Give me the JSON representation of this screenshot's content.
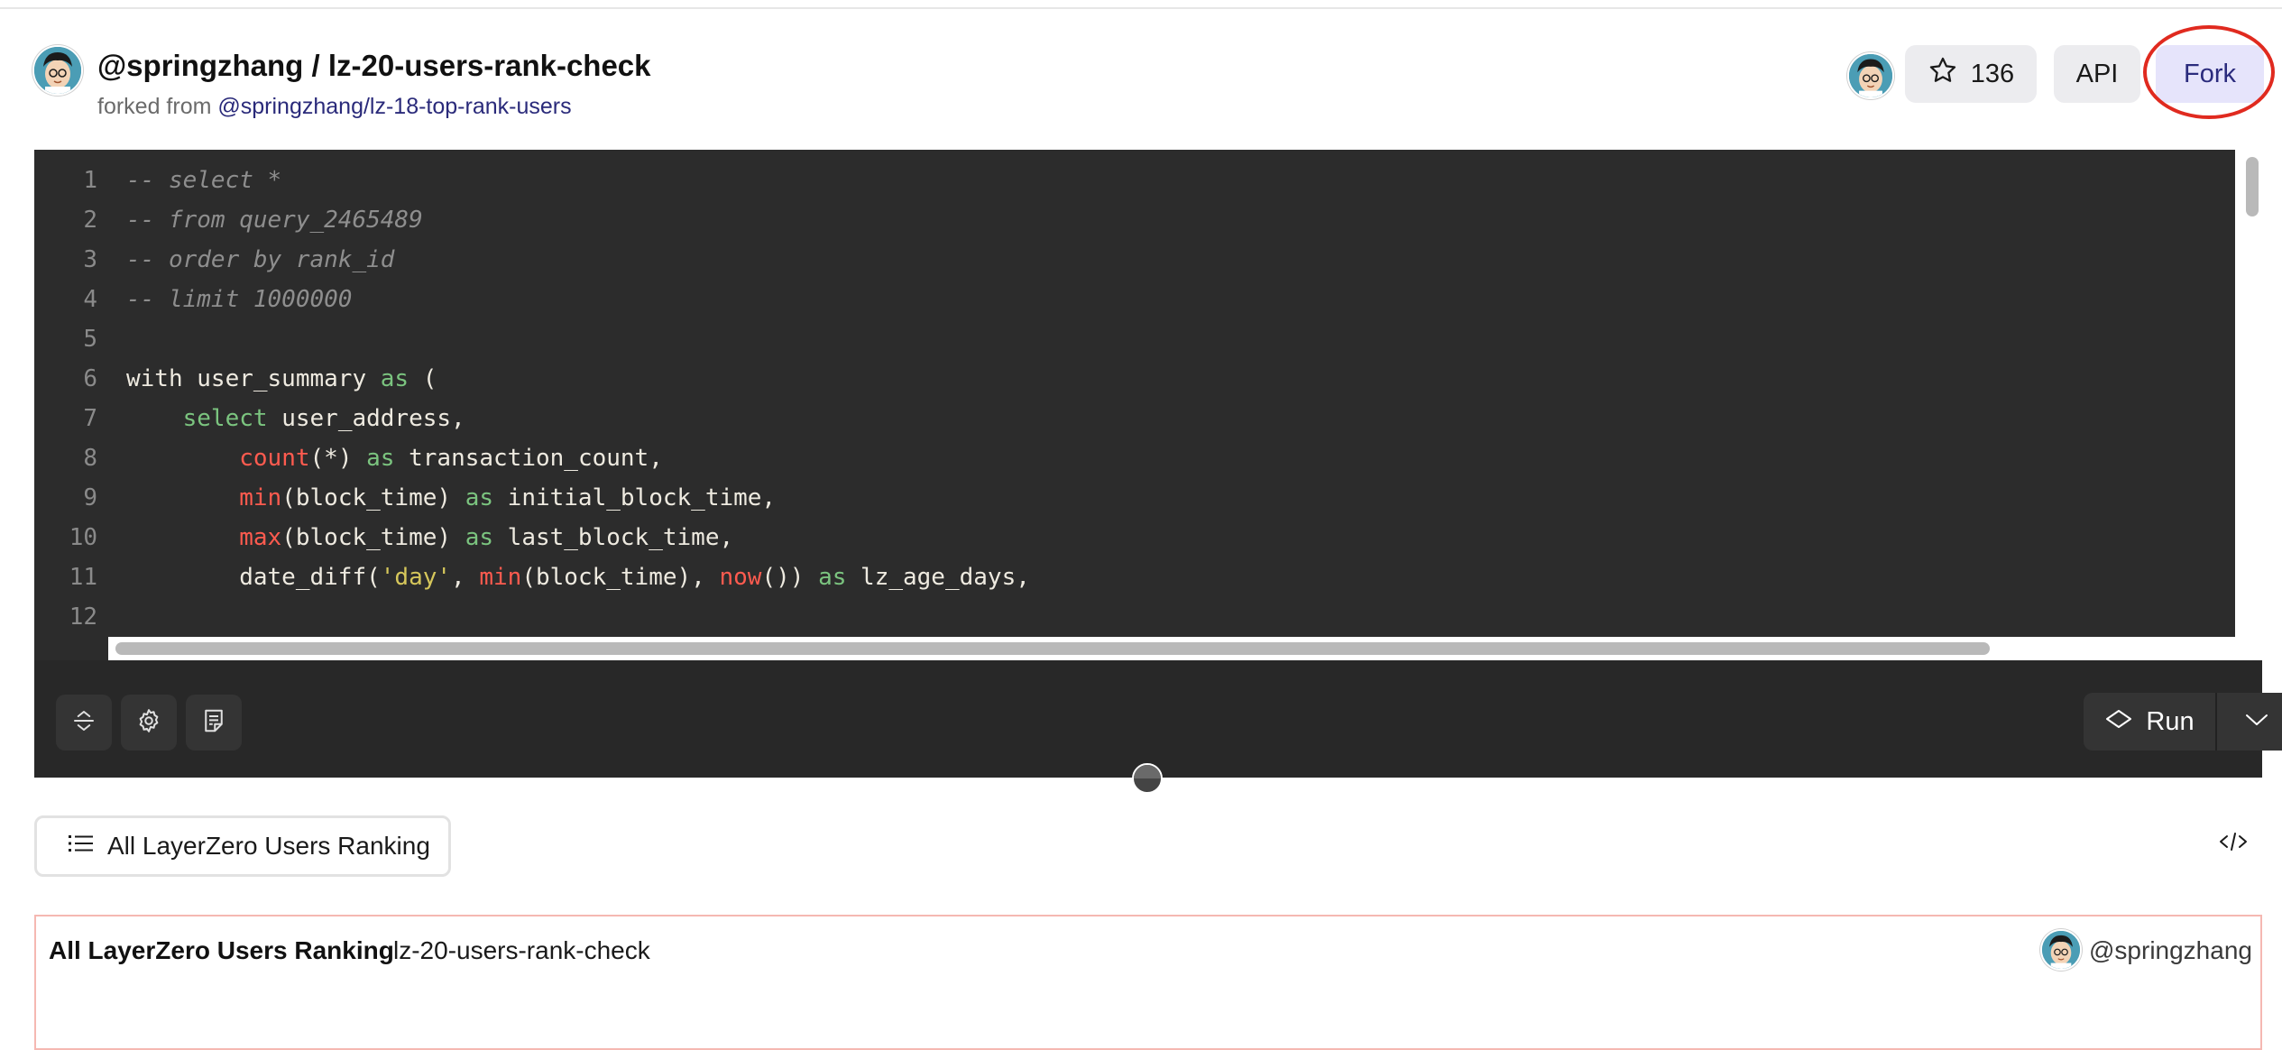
{
  "header": {
    "title": "@springzhang / lz-20-users-rank-check",
    "forked_prefix": "forked from",
    "forked_link": "@springzhang/lz-18-top-rank-users",
    "star_count": "136",
    "api_label": "API",
    "fork_label": "Fork"
  },
  "editor": {
    "lines": [
      {
        "n": "1",
        "segs": [
          {
            "t": "-- select *",
            "c": "com"
          }
        ]
      },
      {
        "n": "2",
        "segs": [
          {
            "t": "-- from query_2465489",
            "c": "com"
          }
        ]
      },
      {
        "n": "3",
        "segs": [
          {
            "t": "-- order by rank_id",
            "c": "com"
          }
        ]
      },
      {
        "n": "4",
        "segs": [
          {
            "t": "-- limit 1000000",
            "c": "com"
          }
        ]
      },
      {
        "n": "5",
        "segs": []
      },
      {
        "n": "6",
        "segs": [
          {
            "t": "with user_summary ",
            "c": ""
          },
          {
            "t": "as",
            "c": "kw"
          },
          {
            "t": " (",
            "c": ""
          }
        ]
      },
      {
        "n": "7",
        "segs": [
          {
            "t": "    ",
            "c": ""
          },
          {
            "t": "select",
            "c": "kw"
          },
          {
            "t": " user_address,",
            "c": ""
          }
        ]
      },
      {
        "n": "8",
        "segs": [
          {
            "t": "        ",
            "c": ""
          },
          {
            "t": "count",
            "c": "fn"
          },
          {
            "t": "(*) ",
            "c": ""
          },
          {
            "t": "as",
            "c": "kw"
          },
          {
            "t": " transaction_count,",
            "c": ""
          }
        ]
      },
      {
        "n": "9",
        "segs": [
          {
            "t": "        ",
            "c": ""
          },
          {
            "t": "min",
            "c": "fn"
          },
          {
            "t": "(block_time) ",
            "c": ""
          },
          {
            "t": "as",
            "c": "kw"
          },
          {
            "t": " initial_block_time,",
            "c": ""
          }
        ]
      },
      {
        "n": "10",
        "segs": [
          {
            "t": "        ",
            "c": ""
          },
          {
            "t": "max",
            "c": "fn"
          },
          {
            "t": "(block_time) ",
            "c": ""
          },
          {
            "t": "as",
            "c": "kw"
          },
          {
            "t": " last_block_time,",
            "c": ""
          }
        ]
      },
      {
        "n": "11",
        "segs": [
          {
            "t": "        date_diff(",
            "c": ""
          },
          {
            "t": "'day'",
            "c": "str"
          },
          {
            "t": ", ",
            "c": ""
          },
          {
            "t": "min",
            "c": "fn"
          },
          {
            "t": "(block_time), ",
            "c": ""
          },
          {
            "t": "now",
            "c": "fn"
          },
          {
            "t": "()) ",
            "c": ""
          },
          {
            "t": "as",
            "c": "kw"
          },
          {
            "t": " lz_age_days,",
            "c": ""
          }
        ]
      },
      {
        "n": "12",
        "segs": []
      }
    ],
    "run_label": "Run"
  },
  "tabs": {
    "viz_tab_label": "All LayerZero Users Ranking"
  },
  "result": {
    "title": "All LayerZero Users Ranking",
    "query_name": "lz-20-users-rank-check",
    "username": "@springzhang"
  },
  "icons": {
    "star": "star-icon",
    "collapse": "collapse-icon",
    "settings": "gear-icon",
    "format": "format-icon",
    "run": "run-icon",
    "caret": "chevron-down-icon",
    "list": "list-icon",
    "embed": "code-icon"
  },
  "colors": {
    "editor_bg": "#2c2c2c",
    "fork_bg": "#e6e4fb",
    "fork_highlight": "#e02a1f",
    "keyword": "#7bc47f",
    "function": "#ff5b4f",
    "string": "#d6c75b",
    "comment": "#8e8e8e"
  }
}
